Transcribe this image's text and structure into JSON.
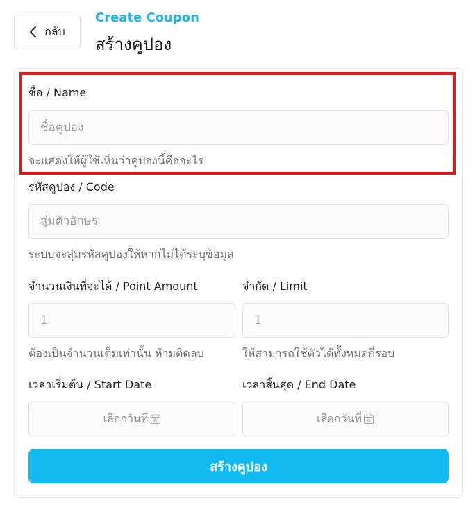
{
  "header": {
    "back_label": "กลับ",
    "subtitle": "Create Coupon",
    "title": "สร้างคูปอง"
  },
  "form": {
    "name": {
      "label": "ชื่อ / Name",
      "placeholder": "ชื่อคูปอง",
      "hint": "จะแสดงให้ผู้ใช้เห็นว่าคูปองนี้คืออะไร"
    },
    "code": {
      "label": "รหัสคูปอง / Code",
      "placeholder": "สุ่มตัวอักษร",
      "hint": "ระบบจะสุ่มรหัสคูปองให้หากไม่ได้ระบุข้อมูล"
    },
    "point_amount": {
      "label": "จำนวนเงินที่จะได้ / Point Amount",
      "placeholder": "1",
      "hint": "ต้องเป็นจำนวนเต็มเท่านั้น ห้ามติดลบ"
    },
    "limit": {
      "label": "จำกัด / Limit",
      "placeholder": "1",
      "hint": "ให้สามารถใช้ตัวได้ทั้งหมดกี่รอบ"
    },
    "start_date": {
      "label": "เวลาเริ่มต้น / Start Date",
      "placeholder": "เลือกวันที่"
    },
    "end_date": {
      "label": "เวลาสิ้นสุด / End Date",
      "placeholder": "เลือกวันที่"
    },
    "submit_label": "สร้างคูปอง"
  },
  "colors": {
    "accent": "#13b9f1",
    "subtitle": "#1fb7ec",
    "highlight": "#e0191e"
  },
  "icons": {
    "back": "chevron-left-icon",
    "calendar": "calendar-icon"
  }
}
